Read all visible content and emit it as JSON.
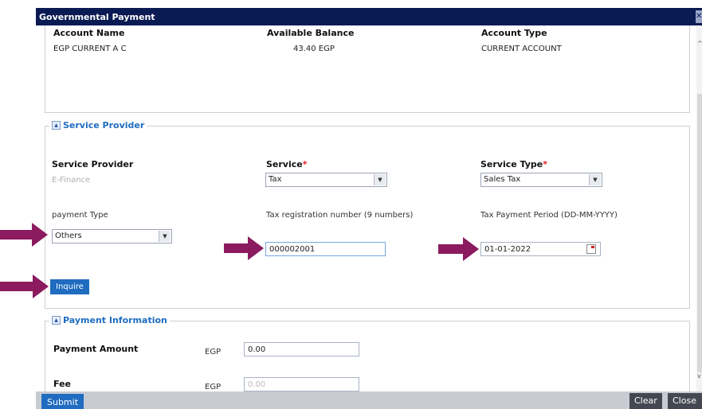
{
  "window": {
    "title": "Governmental Payment"
  },
  "account": {
    "headers": [
      "Account Name",
      "Available Balance",
      "Account Type"
    ],
    "values": [
      "EGP CURRENT A C",
      "43.40 EGP",
      "CURRENT ACCOUNT"
    ]
  },
  "service_provider_section": {
    "legend": "Service Provider",
    "provider_label": "Service Provider",
    "provider_value": "E-Finance",
    "service_label": "Service",
    "service_value": "Tax",
    "service_type_label": "Service Type",
    "service_type_value": "Sales Tax",
    "required_mark": "*",
    "payment_type_label": "payment Type",
    "payment_type_value": "Others",
    "tax_reg_label": "Tax registration number (9 numbers)",
    "tax_reg_value": "000002001",
    "period_label": "Tax Payment Period (DD-MM-YYYY)",
    "period_value": "01-01-2022",
    "inquire_label": "Inquire"
  },
  "payment_section": {
    "legend": "Payment Information",
    "amount_label": "Payment Amount",
    "amount_currency": "EGP",
    "amount_value": "0.00",
    "fee_label": "Fee",
    "fee_currency": "EGP",
    "fee_value": "0.00"
  },
  "bottom_bar": {
    "submit": "Submit",
    "clear": "Clear",
    "close": "Close"
  },
  "icons": {
    "collapse": "collapse-up-icon",
    "dropdown": "chevron-down-icon",
    "calendar": "calendar-icon",
    "annotation": "annotation-arrow-icon"
  },
  "colors": {
    "title_bar": "#0a1a52",
    "accent": "#1f6cc0",
    "required": "#e0201f",
    "annotation_arrow": "#8b1a5e"
  }
}
